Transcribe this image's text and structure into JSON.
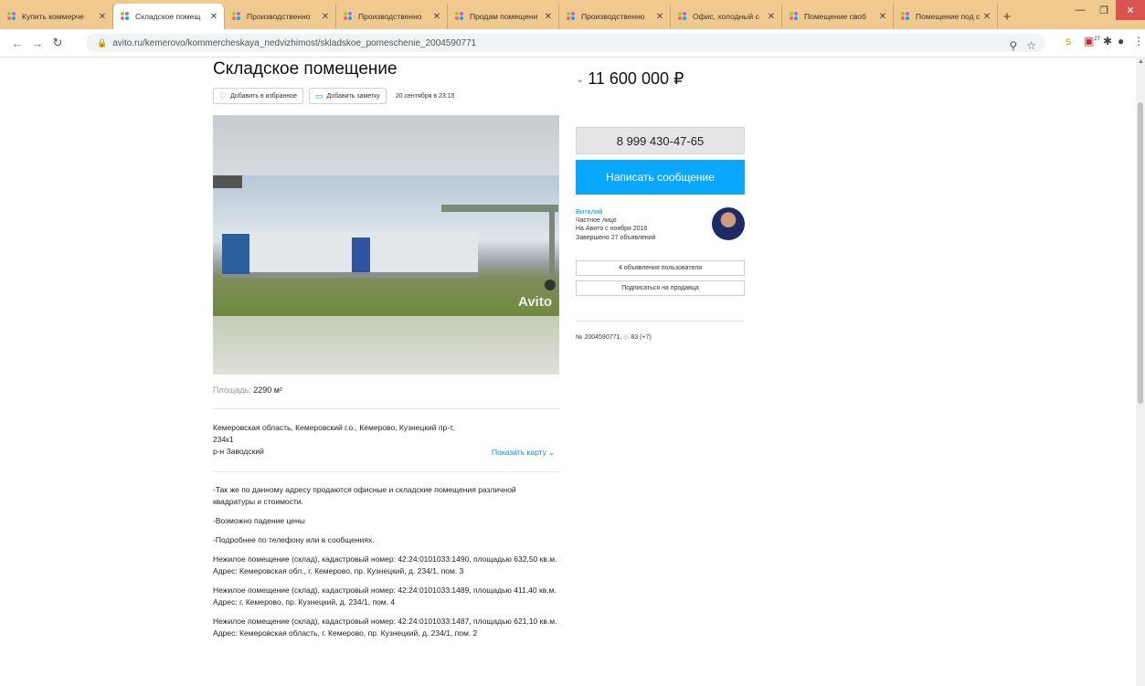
{
  "browser": {
    "tabs": [
      {
        "label": "Купить коммерче",
        "active": false
      },
      {
        "label": "Складское помещ",
        "active": true
      },
      {
        "label": "Производственно",
        "active": false
      },
      {
        "label": "Производственно",
        "active": false
      },
      {
        "label": "Продам помещени",
        "active": false
      },
      {
        "label": "Производственно",
        "active": false
      },
      {
        "label": "Офис, холодный с",
        "active": false
      },
      {
        "label": "Помещение своб",
        "active": false
      },
      {
        "label": "Помещение под с",
        "active": false
      }
    ],
    "url": "avito.ru/kemerovo/kommercheskaya_nedvizhimost/skladskoe_pomeschenie_2004590771",
    "ext_badge": "27"
  },
  "listing": {
    "title": "Складское помещение",
    "add_favorite_label": "Добавить в избранное",
    "add_note_label": "Добавить заметку",
    "date": "20 сентября в 23:15",
    "area_label": "Площадь:",
    "area_value": "2290 м²",
    "address_line1": "Кемеровская область, Кемеровский г.о., Кемерово, Кузнецкий пр-т,",
    "address_line2": "234к1",
    "district": "р-н Заводский",
    "show_map_label": "Показать карту",
    "photo_watermark": "Avito",
    "description": [
      "-Так же по данному адресу продаются офисные и складские помещения различной квадратуры и стоимости.",
      "-Возможно падение цены",
      "-Подробнее по телефону или в сообщениях.",
      "Нежилое помещение (склад), кадастровый номер: 42:24:0101033:1490, площадью 632,50 кв.м.\nАдрес: Кемеровская обл., г. Кемерово, пр. Кузнецкий, д. 234/1, пом. 3",
      "Нежилое помещение (склад), кадастровый номер: 42:24:0101033:1489, площадью 411,40 кв.м.\nАдрес: г. Кемерово, пр. Кузнецкий, д. 234/1, пом. 4",
      "Нежилое помещение (склад), кадастровый номер: 42:24:0101033:1487, площадью 621,10 кв.м.\nАдрес: Кемеровская область, г. Кемерово, пр. Кузнецкий, д. 234/1, пом. 2"
    ]
  },
  "sidebar": {
    "price": "11 600 000 ₽",
    "phone": "8 999 430-47-65",
    "message_label": "Написать сообщение",
    "seller_name": "Виталий",
    "seller_type": "Частное лицо",
    "seller_since": "На Авито с ноября 2016",
    "seller_completed": "Завершено 27 объявлений",
    "user_ads_label": "4 объявления пользователя",
    "subscribe_label": "Подписаться на продавца",
    "ad_number": "№ 2004590771,",
    "views": "83 (+7)"
  },
  "colors": {
    "tab_strip": "#f0c98f",
    "accent_button": "#0aa7ff",
    "link": "#0091d9"
  }
}
